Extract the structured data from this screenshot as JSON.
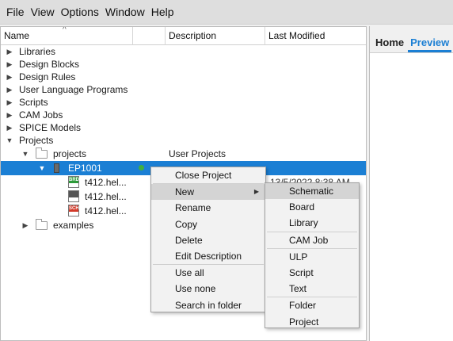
{
  "menubar": [
    "File",
    "View",
    "Options",
    "Window",
    "Help"
  ],
  "columns": {
    "name": "Name",
    "description": "Description",
    "last_modified": "Last Modified"
  },
  "tree": {
    "libraries": "Libraries",
    "design_blocks": "Design Blocks",
    "design_rules": "Design Rules",
    "ulp": "User Language Programs",
    "scripts": "Scripts",
    "cam_jobs": "CAM Jobs",
    "spice_models": "SPICE Models",
    "projects": "Projects",
    "projects_folder": "projects",
    "projects_folder_desc": "User Projects",
    "ep1001": "EP1001",
    "ep1001_lastmod": "13/5/2022 8:38 AM",
    "file_brd": "t412.hel...",
    "file_brd_icon": "BRD",
    "file_gen": "t412.hel...",
    "file_sch": "t412.hel...",
    "file_sch_icon": "SCH",
    "examples": "examples"
  },
  "right_panel": {
    "tab_home": "Home",
    "tab_preview": "Preview"
  },
  "context_menu": {
    "close_project": "Close Project",
    "new": "New",
    "rename": "Rename",
    "copy": "Copy",
    "delete": "Delete",
    "edit_description": "Edit Description",
    "use_all": "Use all",
    "use_none": "Use none",
    "search_in_folder": "Search in folder"
  },
  "new_submenu": {
    "schematic": "Schematic",
    "board": "Board",
    "library": "Library",
    "cam_job": "CAM Job",
    "ulp": "ULP",
    "script": "Script",
    "text": "Text",
    "folder": "Folder",
    "project": "Project"
  },
  "colors": {
    "selection": "#1b7fd4",
    "menu_highlight": "#d4d4d4",
    "brd_green": "#2e9a3a",
    "sch_red": "#d23a2a"
  }
}
